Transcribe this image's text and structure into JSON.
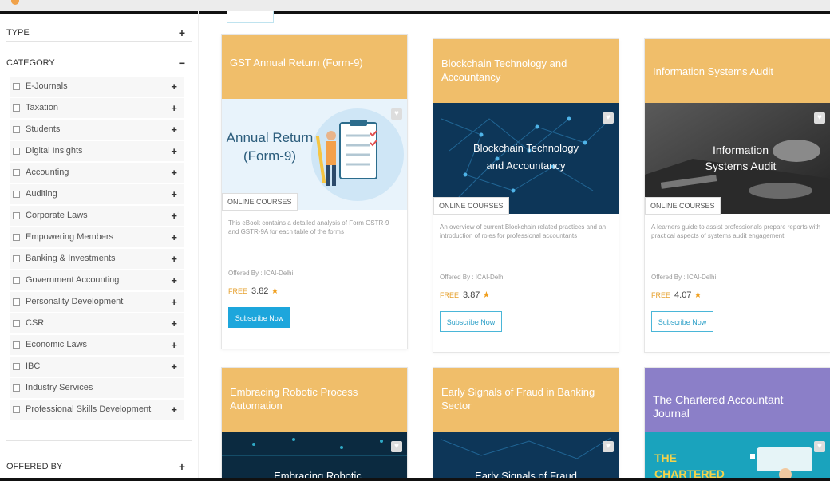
{
  "sidebar": {
    "type_label": "TYPE",
    "type_toggle": "+",
    "category_label": "CATEGORY",
    "category_toggle": "−",
    "categories": [
      {
        "label": "E-Journals",
        "toggle": "+"
      },
      {
        "label": "Taxation",
        "toggle": "+"
      },
      {
        "label": "Students",
        "toggle": "+"
      },
      {
        "label": "Digital Insights",
        "toggle": "+"
      },
      {
        "label": "Accounting",
        "toggle": "+"
      },
      {
        "label": "Auditing",
        "toggle": "+"
      },
      {
        "label": "Corporate Laws",
        "toggle": "+"
      },
      {
        "label": "Empowering Members",
        "toggle": "+"
      },
      {
        "label": "Banking & Investments",
        "toggle": "+"
      },
      {
        "label": "Government Accounting",
        "toggle": "+"
      },
      {
        "label": "Personality Development",
        "toggle": "+"
      },
      {
        "label": "CSR",
        "toggle": "+"
      },
      {
        "label": "Economic Laws",
        "toggle": "+"
      },
      {
        "label": "IBC",
        "toggle": "+"
      },
      {
        "label": "Industry Services",
        "toggle": ""
      },
      {
        "label": "Professional Skills Development",
        "toggle": "+"
      }
    ],
    "offered_label": "OFFERED BY",
    "offered_toggle": "+"
  },
  "cards": [
    {
      "title": "GST Annual Return (Form-9)",
      "image_line1": "Annual Return",
      "image_line2": "(Form-9)",
      "tag": "ONLINE COURSES",
      "description": "This eBook contains a detailed analysis of Form GSTR-9 and GSTR-9A for each table of the forms",
      "offered": "Offered By : ICAI-Delhi",
      "free": "FREE",
      "rating": "3.82",
      "button": "Subscribe Now",
      "header_color": "#f0be6a"
    },
    {
      "title": "Blockchain Technology and Accountancy",
      "image_line1": "Blockchain Technology",
      "image_line2": "and Accountancy",
      "tag": "ONLINE COURSES",
      "description": "An overview of current Blockchain related practices and an introduction of roles for professional accountants",
      "offered": "Offered By : ICAI-Delhi",
      "free": "FREE",
      "rating": "3.87",
      "button": "Subscribe Now",
      "header_color": "#f0be6a"
    },
    {
      "title": "Information Systems Audit",
      "image_line1": "Information",
      "image_line2": "Systems Audit",
      "tag": "ONLINE COURSES",
      "description": "A learners guide to assist professionals prepare reports with practical aspects of systems audit engagement",
      "offered": "Offered By : ICAI-Delhi",
      "free": "FREE",
      "rating": "4.07",
      "button": "Subscribe Now",
      "header_color": "#f0be6a"
    },
    {
      "title": "Embracing Robotic Process Automation",
      "image_line1": "Embracing Robotic",
      "header_color": "#f0be6a"
    },
    {
      "title": "Early Signals of Fraud in Banking Sector",
      "image_line1": "Early Signals of Fraud",
      "header_color": "#f0be6a"
    },
    {
      "title": "The Chartered Accountant Journal",
      "image_line1": "THE",
      "image_line2": "CHARTERED",
      "header_color": "#8b7fc8"
    }
  ],
  "star_glyph": "★",
  "heart_glyph": "♥"
}
